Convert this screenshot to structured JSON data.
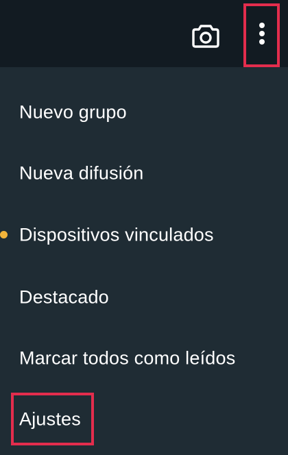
{
  "app": {
    "icons": {
      "camera": "camera-icon",
      "more": "more-vert-icon"
    },
    "colors": {
      "highlight": "#e32d4d",
      "unread_dot": "#f2b43a",
      "menu_bg": "#1f2c34",
      "topbar_bg": "#121b22"
    }
  },
  "menu": {
    "items": [
      {
        "label": "Nuevo grupo"
      },
      {
        "label": "Nueva difusión"
      },
      {
        "label": "Dispositivos vinculados",
        "has_dot": true
      },
      {
        "label": "Destacado"
      },
      {
        "label": "Marcar todos como leídos"
      },
      {
        "label": "Ajustes",
        "highlighted": true
      }
    ]
  }
}
